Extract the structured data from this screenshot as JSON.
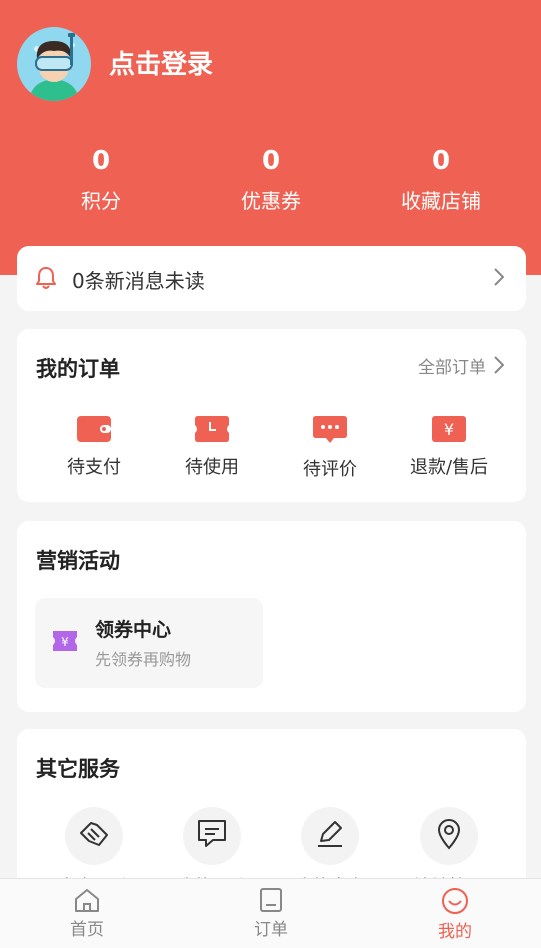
{
  "user": {
    "login_text": "点击登录"
  },
  "stats": [
    {
      "value": "0",
      "label": "积分"
    },
    {
      "value": "0",
      "label": "优惠券"
    },
    {
      "value": "0",
      "label": "收藏店铺"
    }
  ],
  "messages": {
    "text": "0条新消息未读"
  },
  "orders": {
    "title": "我的订单",
    "all_label": "全部订单",
    "items": [
      {
        "label": "待支付",
        "icon": "wallet-icon"
      },
      {
        "label": "待使用",
        "icon": "ticket-clock-icon"
      },
      {
        "label": "待评价",
        "icon": "comment-dots-icon"
      },
      {
        "label": "退款/售后",
        "icon": "yen-icon"
      }
    ]
  },
  "marketing": {
    "title": "营销活动",
    "coupon_center": {
      "title": "领券中心",
      "subtitle": "先领券再购物",
      "icon": "coupon-icon"
    }
  },
  "services": {
    "title": "其它服务",
    "items": [
      {
        "label": "商家入驻",
        "icon": "handshake-icon"
      },
      {
        "label": "我的评价",
        "icon": "comment-icon"
      },
      {
        "label": "我的发布",
        "icon": "edit-icon"
      },
      {
        "label": "地址管理",
        "icon": "location-icon"
      }
    ]
  },
  "tabbar": {
    "items": [
      {
        "label": "首页",
        "icon": "home-icon",
        "active": false
      },
      {
        "label": "订单",
        "icon": "order-icon",
        "active": false
      },
      {
        "label": "我的",
        "icon": "smile-icon",
        "active": true
      }
    ]
  },
  "colors": {
    "brand": "#ef6152",
    "coupon_purple": "#b267e8"
  }
}
